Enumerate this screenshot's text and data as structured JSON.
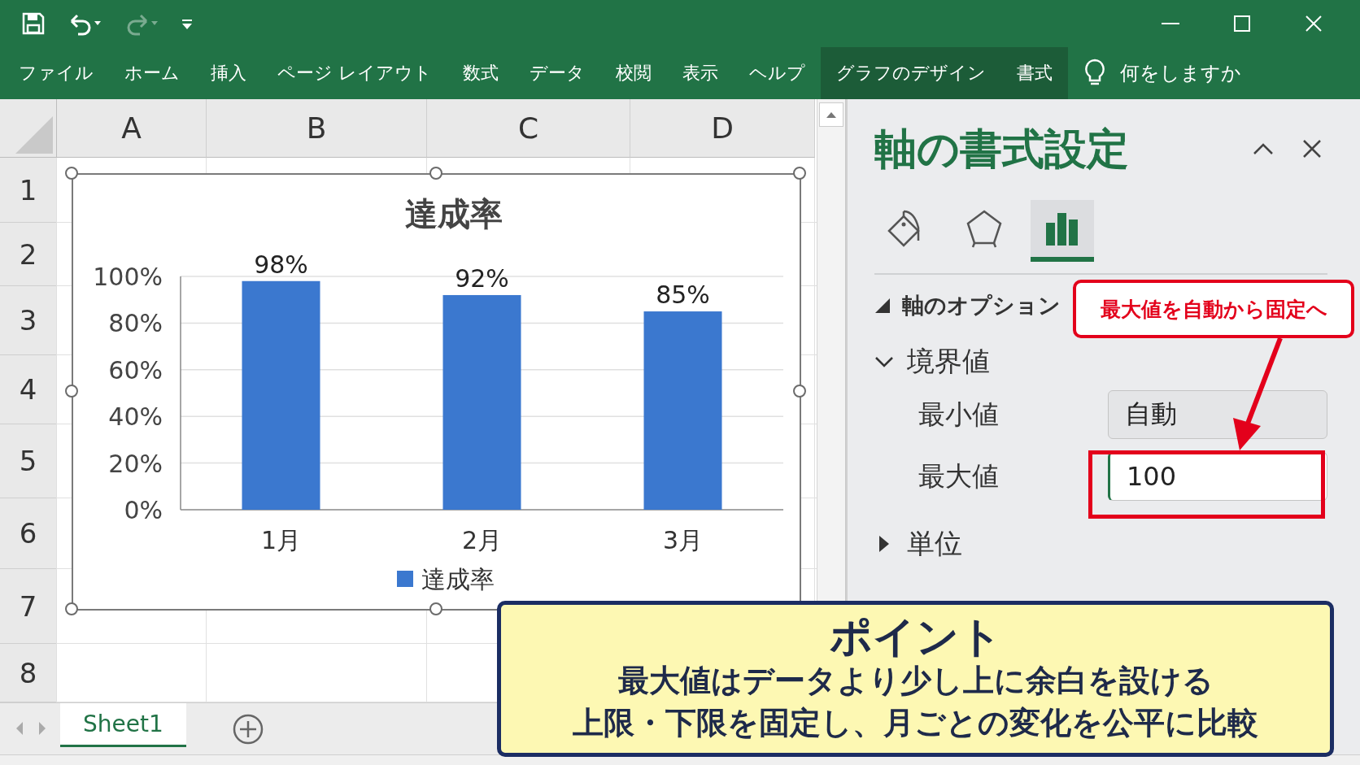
{
  "quick_access": [
    {
      "kind": "save",
      "disabled": false
    },
    {
      "kind": "undo",
      "disabled": false
    },
    {
      "kind": "redo",
      "disabled": true
    },
    {
      "kind": "customize",
      "disabled": false
    }
  ],
  "ribbon_tabs": [
    {
      "label": "ファイル",
      "contextual": false
    },
    {
      "label": "ホーム",
      "contextual": false
    },
    {
      "label": "挿入",
      "contextual": false
    },
    {
      "label": "ページ レイアウト",
      "contextual": false
    },
    {
      "label": "数式",
      "contextual": false
    },
    {
      "label": "データ",
      "contextual": false
    },
    {
      "label": "校閲",
      "contextual": false
    },
    {
      "label": "表示",
      "contextual": false
    },
    {
      "label": "ヘルプ",
      "contextual": false
    },
    {
      "label": "グラフのデザイン",
      "contextual": true
    },
    {
      "label": "書式",
      "contextual": true
    }
  ],
  "tell_me": {
    "label": "何をしますか"
  },
  "sheet": {
    "columns": [
      "A",
      "B",
      "C",
      "D"
    ],
    "rows": [
      "1",
      "2",
      "3",
      "4",
      "5",
      "6",
      "7",
      "8"
    ]
  },
  "chart": {
    "chart_data": {
      "type": "bar",
      "title": "達成率",
      "categories": [
        "1月",
        "2月",
        "3月"
      ],
      "series": [
        {
          "name": "達成率",
          "color": "#3b78cf",
          "values": [
            98,
            92,
            85
          ]
        }
      ],
      "ylim": [
        0,
        100
      ],
      "yticks": [
        {
          "value": 0,
          "label": "0%"
        },
        {
          "value": 20,
          "label": "20%"
        },
        {
          "value": 40,
          "label": "40%"
        },
        {
          "value": 60,
          "label": "60%"
        },
        {
          "value": 80,
          "label": "80%"
        },
        {
          "value": 100,
          "label": "100%"
        }
      ],
      "grid": true,
      "data_labels": "value_labels",
      "value_labels": [
        "98%",
        "92%",
        "85%"
      ]
    }
  },
  "sheet_tabs": [
    {
      "label": "Sheet1",
      "selected": true
    }
  ],
  "pane": {
    "title": "軸の書式設定",
    "icon_tabs": [
      {
        "kind": "fill",
        "selected": false
      },
      {
        "kind": "effects",
        "selected": false
      },
      {
        "kind": "axis",
        "selected": true
      }
    ],
    "section": {
      "label": "軸のオプション",
      "expanded": true
    },
    "groups": [
      {
        "label": "境界値",
        "expanded": true,
        "fields": [
          {
            "label": "最小値",
            "value": "自動",
            "focused": false
          },
          {
            "label": "最大値",
            "value": "100",
            "focused": true
          }
        ]
      },
      {
        "label": "単位",
        "expanded": false
      }
    ]
  },
  "callout": {
    "text": "最大値を自動から固定へ"
  },
  "point_box": {
    "title": "ポイント",
    "lines": [
      "最大値はデータより少し上に余白を設ける",
      "上限・下限を固定し、月ごとの変化を公平に比較"
    ]
  }
}
